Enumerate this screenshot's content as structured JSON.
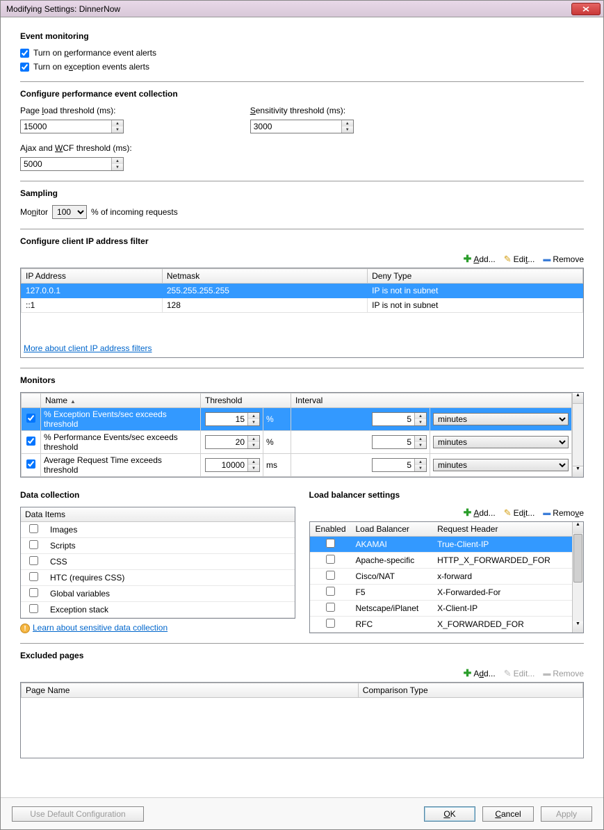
{
  "window_title": "Modifying Settings: DinnerNow",
  "event_monitoring": {
    "heading": "Event monitoring",
    "perf_alerts": {
      "checked": true,
      "label_pre": "Turn on ",
      "label_u": "p",
      "label_post": "erformance event alerts"
    },
    "exc_alerts": {
      "checked": true,
      "label_pre": "Turn on e",
      "label_u": "x",
      "label_post": "ception events alerts"
    }
  },
  "perf_collection": {
    "heading": "Configure performance event collection",
    "page_load": {
      "label_pre": "Page ",
      "u": "l",
      "label_post": "oad threshold (ms):",
      "value": "15000"
    },
    "sensitivity": {
      "u": "S",
      "label_post": "ensitivity threshold (ms):",
      "value": "3000"
    },
    "ajax": {
      "label_pre": "Ajax and ",
      "u": "W",
      "label_post": "CF threshold (ms):",
      "value": "5000"
    }
  },
  "sampling": {
    "heading": "Sampling",
    "label_pre": "Mo",
    "u": "n",
    "label_post": "itor",
    "value": "100",
    "suffix": "% of incoming requests"
  },
  "ip_filter": {
    "heading": "Configure client IP address filter",
    "actions": {
      "add_u": "A",
      "add_post": "dd...",
      "edit_pre": "Edi",
      "edit_u": "t",
      "edit_post": "...",
      "remove": "Remove"
    },
    "columns": [
      "IP Address",
      "Netmask",
      "Deny Type"
    ],
    "rows": [
      {
        "ip": "127.0.0.1",
        "netmask": "255.255.255.255",
        "deny": "IP is not in subnet",
        "selected": true
      },
      {
        "ip": "::1",
        "netmask": "128",
        "deny": "IP is not in subnet",
        "selected": false
      }
    ],
    "link": "More about client IP address filters"
  },
  "monitors": {
    "heading": "Monitors",
    "columns": {
      "name": "Name",
      "threshold": "Threshold",
      "interval": "Interval"
    },
    "unit_options": [
      "minutes"
    ],
    "rows": [
      {
        "checked": true,
        "name": "% Exception Events/sec exceeds threshold",
        "threshold": "15",
        "unit_after": "%",
        "interval": "5",
        "interval_unit": "minutes",
        "selected": true
      },
      {
        "checked": true,
        "name": "% Performance Events/sec exceeds threshold",
        "threshold": "20",
        "unit_after": "%",
        "interval": "5",
        "interval_unit": "minutes",
        "selected": false
      },
      {
        "checked": true,
        "name": "Average Request Time exceeds threshold",
        "threshold": "10000",
        "unit_after": "ms",
        "interval": "5",
        "interval_unit": "minutes",
        "selected": false
      }
    ]
  },
  "data_collection": {
    "heading": "Data collection",
    "col": "Data Items",
    "items": [
      {
        "checked": false,
        "name": "Images"
      },
      {
        "checked": false,
        "name": "Scripts"
      },
      {
        "checked": false,
        "name": "CSS"
      },
      {
        "checked": false,
        "name": "HTC (requires CSS)"
      },
      {
        "checked": false,
        "name": "Global variables"
      },
      {
        "checked": false,
        "name": "Exception stack"
      }
    ],
    "link": "Learn about sensitive data collection"
  },
  "load_balancer": {
    "heading": "Load balancer settings",
    "actions": {
      "add_u": "A",
      "add_post": "dd...",
      "edit_pre": "Ed",
      "edit_u": "i",
      "edit_post": "t...",
      "remove_pre": "Remo",
      "remove_u": "v",
      "remove_post": "e"
    },
    "columns": [
      "Enabled",
      "Load Balancer",
      "Request Header"
    ],
    "rows": [
      {
        "enabled": false,
        "name": "AKAMAI",
        "header": "True-Client-IP",
        "selected": true
      },
      {
        "enabled": false,
        "name": "Apache-specific",
        "header": "HTTP_X_FORWARDED_FOR",
        "selected": false
      },
      {
        "enabled": false,
        "name": "Cisco/NAT",
        "header": "x-forward",
        "selected": false
      },
      {
        "enabled": false,
        "name": "F5",
        "header": "X-Forwarded-For",
        "selected": false
      },
      {
        "enabled": false,
        "name": "Netscape/iPlanet",
        "header": "X-Client-IP",
        "selected": false
      },
      {
        "enabled": false,
        "name": "RFC",
        "header": "X_FORWARDED_FOR",
        "selected": false
      }
    ]
  },
  "excluded": {
    "heading": "Excluded pages",
    "actions": {
      "add_pre": "A",
      "add_u": "d",
      "add_post": "d...",
      "edit": "Edit...",
      "remove": "Remove"
    },
    "columns": [
      "Page Name",
      "Comparison Type"
    ]
  },
  "buttons": {
    "default_cfg": "Use Default Configuration",
    "ok_u": "O",
    "ok_post": "K",
    "cancel_u": "C",
    "cancel_post": "ancel",
    "apply": "Apply"
  }
}
